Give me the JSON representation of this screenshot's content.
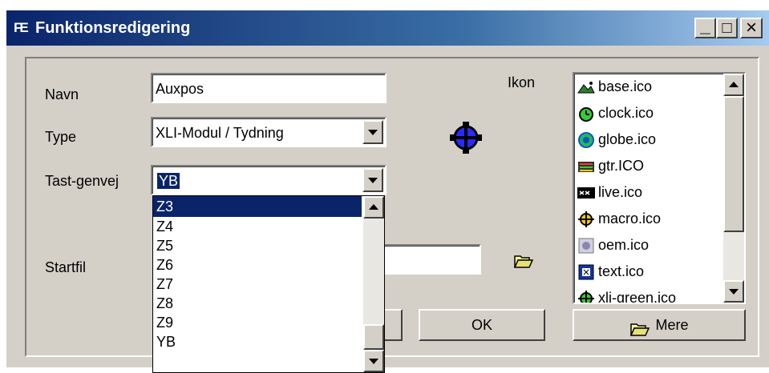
{
  "window": {
    "title": "Funktionsredigering",
    "app_icon_text": "FE"
  },
  "caption_buttons": {
    "minimize": "_",
    "maximize": "□",
    "close": "×"
  },
  "form": {
    "name_label": "Navn",
    "name_value": "Auxpos",
    "type_label": "Type",
    "type_value": "XLI-Modul / Tydning",
    "shortcut_label": "Tast-genvej",
    "shortcut_value": "YB",
    "startfile_label": "Startfil",
    "icon_label": "Ikon"
  },
  "shortcut_dropdown": {
    "options": [
      "Z3",
      "Z4",
      "Z5",
      "Z6",
      "Z7",
      "Z8",
      "Z9",
      "YB"
    ],
    "highlighted": "Z3"
  },
  "icon_list": {
    "items": [
      {
        "label": "base.ico",
        "icon": "base-icon"
      },
      {
        "label": "clock.ico",
        "icon": "clock-icon"
      },
      {
        "label": "globe.ico",
        "icon": "globe-icon"
      },
      {
        "label": "gtr.ICO",
        "icon": "gtr-icon"
      },
      {
        "label": "live.ico",
        "icon": "live-icon"
      },
      {
        "label": "macro.ico",
        "icon": "macro-icon"
      },
      {
        "label": "oem.ico",
        "icon": "oem-icon"
      },
      {
        "label": "text.ico",
        "icon": "text-icon"
      },
      {
        "label": "xli-green.ico",
        "icon": "xli-green-icon"
      }
    ]
  },
  "buttons": {
    "ok": "OK",
    "more": "Mere"
  },
  "colors": {
    "titlebar_start": "#0a246a",
    "titlebar_end": "#a6caf0",
    "face": "#d4d0c8",
    "selection": "#0a246a"
  }
}
